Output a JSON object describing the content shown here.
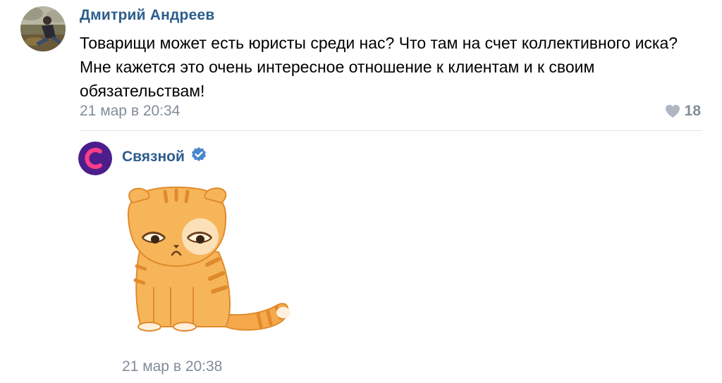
{
  "comment": {
    "author": "Дмитрий Андреев",
    "text": "Товарищи может есть юристы среди нас? Что там на счет коллективного иска? Мне кажется это очень интересное отношение к клиентам и к своим обязательствам!",
    "timestamp": "21 мар в 20:34",
    "likes": "18",
    "like_icon": "heart-icon"
  },
  "reply": {
    "author": "Связной",
    "verified_icon": "verified-badge-icon",
    "sticker": "sad-cat-sticker",
    "timestamp": "21 мар в 20:38"
  },
  "colors": {
    "author": "#2c5d8c",
    "meta": "#818c99",
    "divider": "#e1e3e6",
    "verified": "#4986cc",
    "brand": "#4b1e8c"
  }
}
